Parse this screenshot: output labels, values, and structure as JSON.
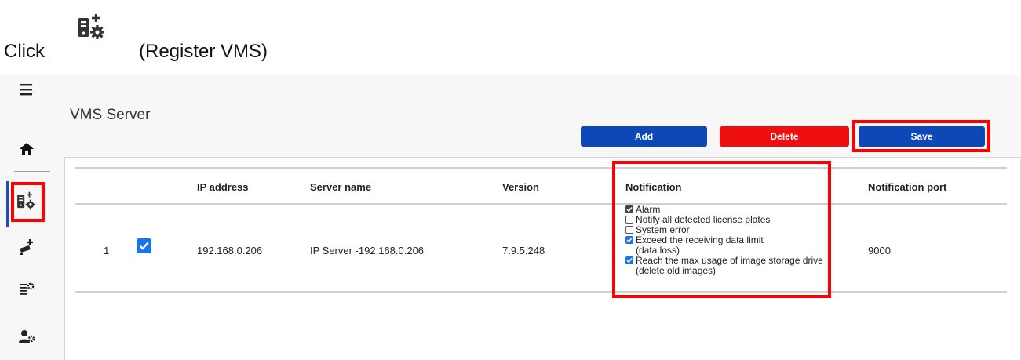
{
  "instruction": {
    "click_word": "Click",
    "caption": "(Register VMS)",
    "icon": "register-vms-icon"
  },
  "sidebar": {
    "items": [
      {
        "name": "menu-icon"
      },
      {
        "name": "home-icon"
      },
      {
        "name": "register-vms-icon"
      },
      {
        "name": "add-camera-icon"
      },
      {
        "name": "list-settings-icon"
      },
      {
        "name": "user-settings-icon"
      }
    ]
  },
  "page": {
    "title": "VMS Server"
  },
  "toolbar": {
    "add_label": "Add",
    "delete_label": "Delete",
    "save_label": "Save"
  },
  "table": {
    "columns": [
      "IP address",
      "Server name",
      "Version",
      "Notification",
      "Notification port"
    ],
    "rows": [
      {
        "index": "1",
        "checked": true,
        "ip": "192.168.0.206",
        "server_name": "IP Server -192.168.0.206",
        "version": "7.9.5.248",
        "notification_port": "9000",
        "notifications": [
          {
            "label": "Alarm",
            "sub": "",
            "checked": true
          },
          {
            "label": "Notify all detected license plates",
            "sub": "",
            "checked": false
          },
          {
            "label": "System error",
            "sub": "",
            "checked": false
          },
          {
            "label": "Exceed the receiving data limit",
            "sub": "(data loss)",
            "checked": true
          },
          {
            "label": "Reach the max usage of image storage drive",
            "sub": "(delete old images)",
            "checked": true
          }
        ]
      }
    ]
  },
  "colors": {
    "primary_button": "#0d47b8",
    "delete_button": "#f00f0f",
    "highlight": "#ff0000",
    "checkbox": "#1a73e8"
  }
}
